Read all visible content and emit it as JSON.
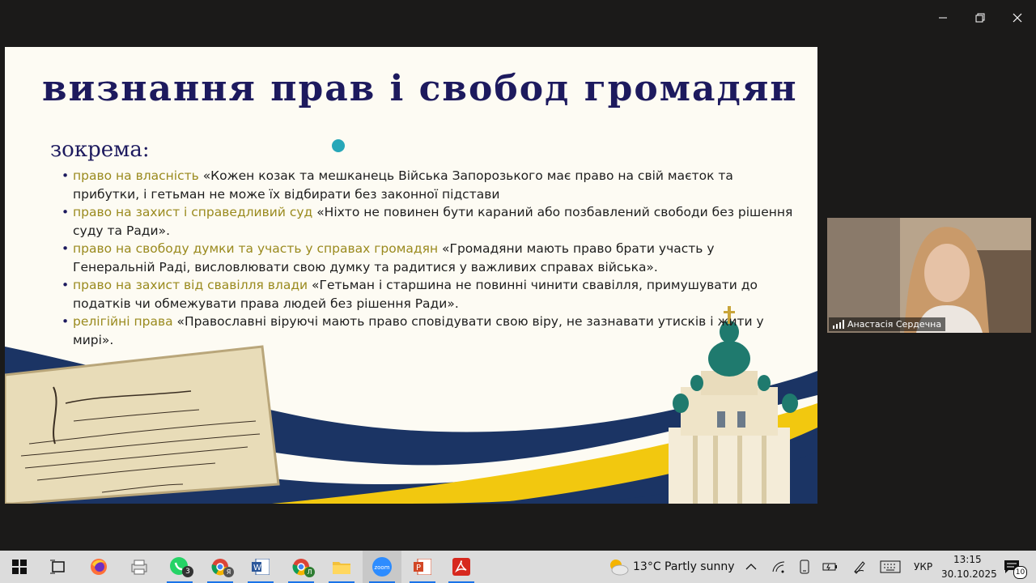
{
  "slide": {
    "title": "визнання прав і свобод громадян",
    "subheading": "зокрема:",
    "bullets": [
      {
        "highlight": "право на власність",
        "text": " «Кожен козак та мешканець Війська Запорозького має право на свій маєток та прибутки, і гетьман не може їх відбирати без законної підстави"
      },
      {
        "highlight": "право на захист і справедливий суд",
        "text": " «Ніхто не повинен бути караний або позбавлений свободи без рішення суду та Ради»."
      },
      {
        "highlight": "право на свободу думки та участь у справах громадян",
        "text": " «Громадяни мають право брати участь у Генеральній Раді, висловлювати свою думку та радитися у важливих справах війська»."
      },
      {
        "highlight": "право на захист від свавілля влади",
        "text": " «Гетьман і старшина не повинні чинити свавілля, примушувати до податків чи обмежувати права людей без рішення Ради»."
      },
      {
        "highlight": "релігійні права",
        "text": " «Православні віруючі мають право сповідувати свою віру, не зазнавати утисків і жити у мирі»."
      }
    ]
  },
  "video": {
    "participant_name": "Анастасія Сердечна"
  },
  "taskbar": {
    "whatsapp_badge": "3",
    "weather": "13°C  Partly sunny",
    "language": "УКР",
    "time": "13:15",
    "date": "30.10.2025",
    "notifications": "10",
    "zoom_label": "zoom",
    "chrome_profile_1": "Я",
    "chrome_profile_2": "Л"
  },
  "colors": {
    "title": "#1d1a5e",
    "highlight": "#9a8a1e",
    "navy": "#1b3464",
    "yellow": "#f2c80f"
  }
}
